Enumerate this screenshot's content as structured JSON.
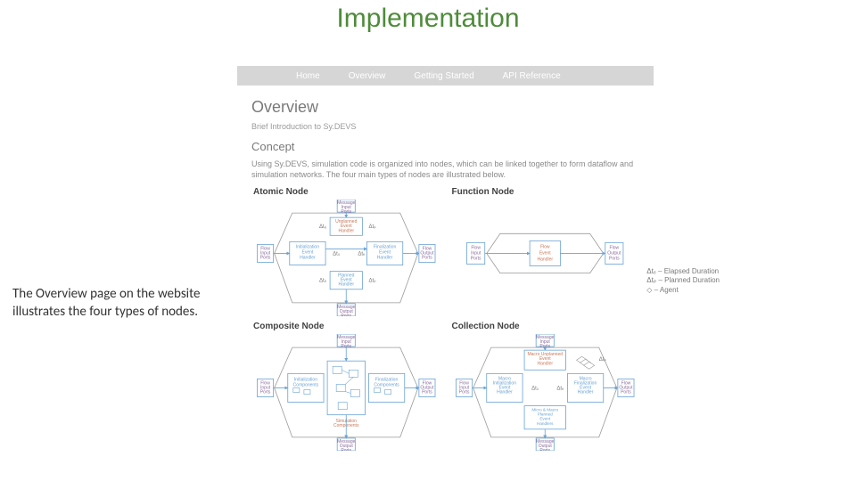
{
  "slide": {
    "title": "Implementation",
    "caption": "The Overview page on the website illustrates the four types of nodes."
  },
  "nav": {
    "items": [
      "Home",
      "Overview",
      "Getting Started",
      "API Reference"
    ]
  },
  "page": {
    "heading": "Overview",
    "subheading": "Brief Introduction to Sy.DEVS",
    "section": "Concept",
    "paragraph": "Using Sy.DEVS, simulation code is organized into nodes, which can be linked together to form dataflow and simulation networks. The four main types of nodes are illustrated below."
  },
  "diagrams": {
    "atomic": {
      "title": "Atomic Node",
      "msg_in": "Message\nInput\nPorts",
      "msg_out": "Message\nOutput\nPorts",
      "flow_in": "Flow\nInput\nPorts",
      "flow_out": "Flow\nOutput\nPorts",
      "init": "Initialization\nEvent\nHandler",
      "final": "Finalization\nEvent\nHandler",
      "unplanned": "Unplanned\nEvent\nHandler",
      "planned": "Planned\nEvent\nHandler",
      "dt0": "Δt₀",
      "dte": "Δtₑ",
      "dtp": "Δtₚ"
    },
    "function": {
      "title": "Function Node",
      "flow_in": "Flow\nInput\nPorts",
      "flow_out": "Flow\nOutput\nPorts",
      "handler": "Flow\nEvent\nHandler"
    },
    "composite": {
      "title": "Composite Node",
      "msg_in": "Message\nInput\nPorts",
      "msg_out": "Message\nOutput\nPorts",
      "flow_in": "Flow\nInput\nPorts",
      "flow_out": "Flow\nOutput\nPorts",
      "init": "Initialization\nComponents",
      "final": "Finalization\nComponents",
      "sim": "Simulation\nComponents"
    },
    "collection": {
      "title": "Collection Node",
      "msg_in": "Message\nInput\nPorts",
      "msg_out": "Message\nOutput\nPorts",
      "flow_in": "Flow\nInput\nPorts",
      "flow_out": "Flow\nOutput\nPorts",
      "macro_init": "Macro\nInitialization\nEvent\nHandler",
      "macro_final": "Macro\nFinalization\nEvent\nHandler",
      "macro_unplanned": "Macro Unplanned\nEvent\nHandler",
      "micro_macro": "Micro & Macro\nPlanned\nEvent\nHandlers",
      "dt0": "Δt₀",
      "dte": "Δtₑ",
      "dtp": "Δtₚ"
    }
  },
  "legend": {
    "l1": "Δtₑ – Elapsed Duration",
    "l2": "Δtₚ – Planned Duration",
    "l3": "◇ – Agent"
  }
}
